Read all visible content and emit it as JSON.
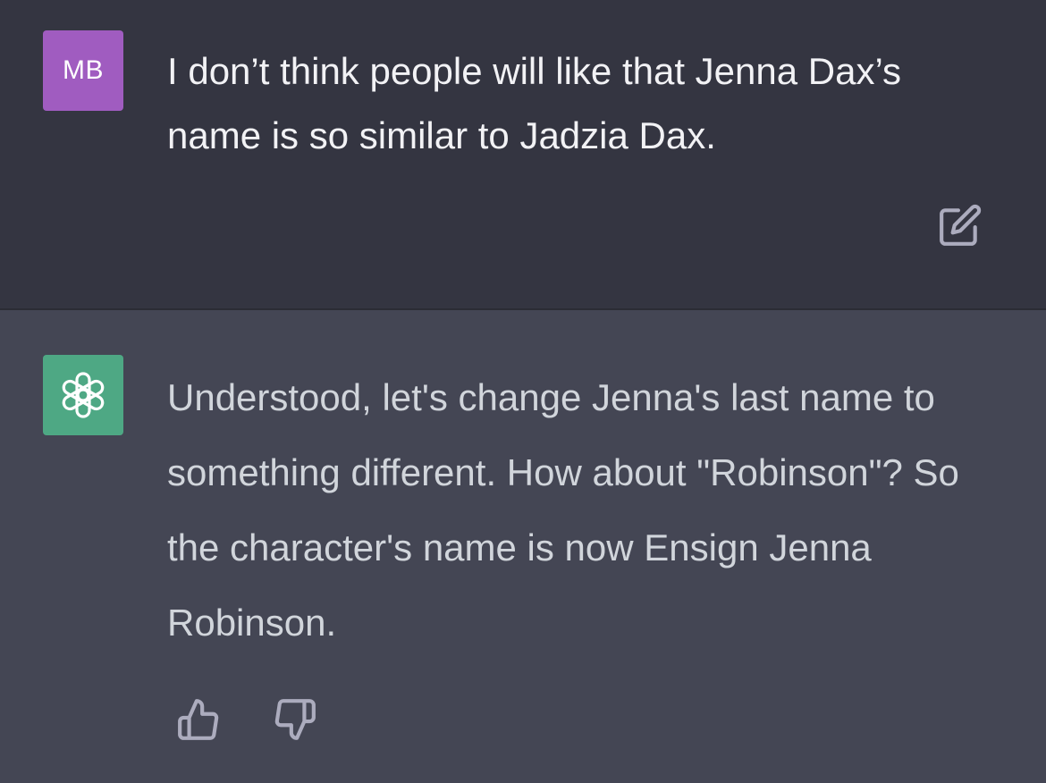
{
  "user_message": {
    "avatar_initials": "MB",
    "avatar_color": "#a05cc0",
    "text": "I don’t think people will like that Jenna Dax’s name is so similar to Jadzia Dax.",
    "edit_icon": "edit-icon"
  },
  "assistant_message": {
    "avatar_icon": "openai-logo-icon",
    "avatar_color": "#4ea884",
    "text": "Understood, let's change Jenna's last name to something different. How about \"Robinson\"? So the character's name is now Ensign Jenna Robinson.",
    "feedback": {
      "thumbs_up_icon": "thumbs-up-icon",
      "thumbs_down_icon": "thumbs-down-icon"
    }
  },
  "colors": {
    "user_bg": "#343541",
    "assistant_bg": "#444654",
    "text": "#d1d5db",
    "icon": "#acacbe"
  }
}
